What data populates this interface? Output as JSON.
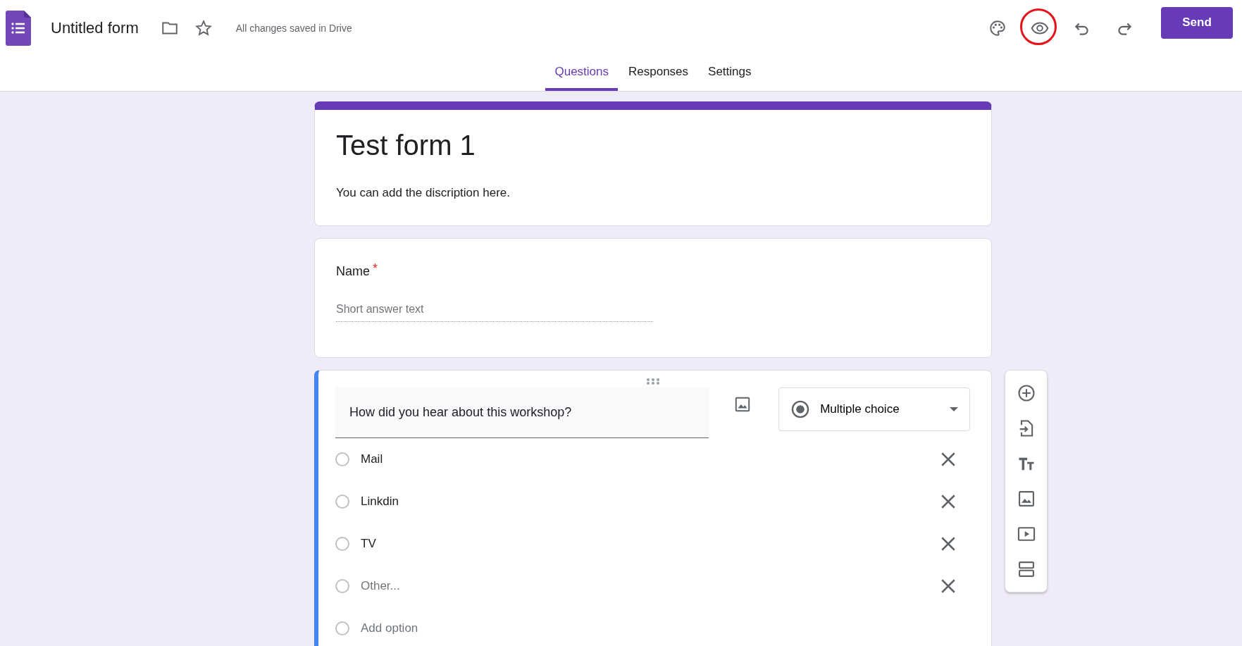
{
  "header": {
    "title": "Untitled form",
    "save_status": "All changes saved in Drive",
    "actions": [
      {
        "kind": "palette",
        "highlighted": false
      },
      {
        "kind": "preview",
        "highlighted": true
      },
      {
        "kind": "undo",
        "highlighted": false
      },
      {
        "kind": "redo",
        "highlighted": false
      }
    ],
    "send_button": "Send"
  },
  "tabs": [
    {
      "label": "Questions",
      "selected": true
    },
    {
      "label": "Responses",
      "selected": false
    },
    {
      "label": "Settings",
      "selected": false
    }
  ],
  "form_header": {
    "title": "Test form 1",
    "description": "You can add the discription here."
  },
  "questions": [
    {
      "title": "Name",
      "required_mark": "*",
      "kind": "short_answer",
      "placeholder": "Short answer text"
    },
    {
      "title": "How did you hear about this workshop?",
      "kind": "multiple_choice",
      "type_label": "Multiple choice",
      "options": [
        {
          "label": "Mail",
          "kind": "option",
          "selected": false
        },
        {
          "label": "Linkdin",
          "kind": "option",
          "selected": false
        },
        {
          "label": "TV",
          "kind": "option",
          "selected": false
        },
        {
          "label": "Other...",
          "kind": "other",
          "selected": false
        },
        {
          "label": "Add option",
          "kind": "add",
          "selected": false
        }
      ]
    }
  ],
  "side_toolbar": [
    {
      "kind": "add_question"
    },
    {
      "kind": "import"
    },
    {
      "kind": "title"
    },
    {
      "kind": "image"
    },
    {
      "kind": "video"
    },
    {
      "kind": "section"
    }
  ]
}
